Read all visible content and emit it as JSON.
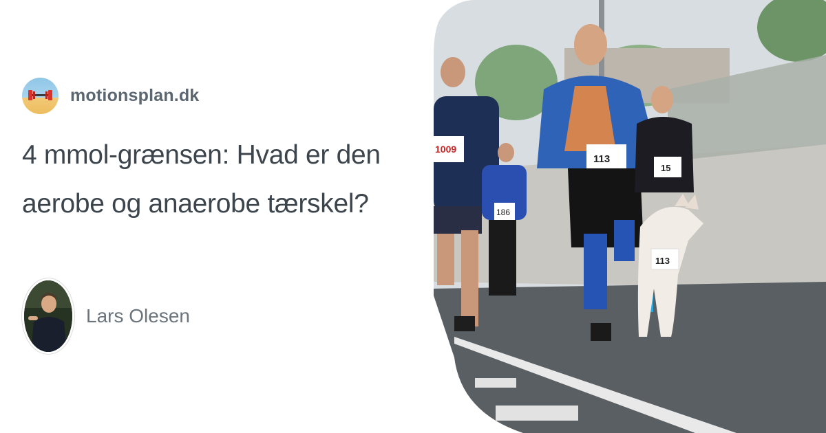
{
  "site": {
    "name": "motionsplan.dk",
    "logo_icon": "dumbbell-beach-logo"
  },
  "article": {
    "title": "4 mmol-grænsen: Hvad er den aerobe og anaerobe tærskel?"
  },
  "author": {
    "name": "Lars Olesen"
  },
  "photo": {
    "bibs": [
      "1009",
      "186",
      "113",
      "15",
      "113"
    ],
    "colors": {
      "sky": "#d7dde0",
      "road": "#5a5f63",
      "wall": "#c9c7c2",
      "jersey_blue": "#2f63b8",
      "jersey_orange": "#f08a3c"
    }
  }
}
